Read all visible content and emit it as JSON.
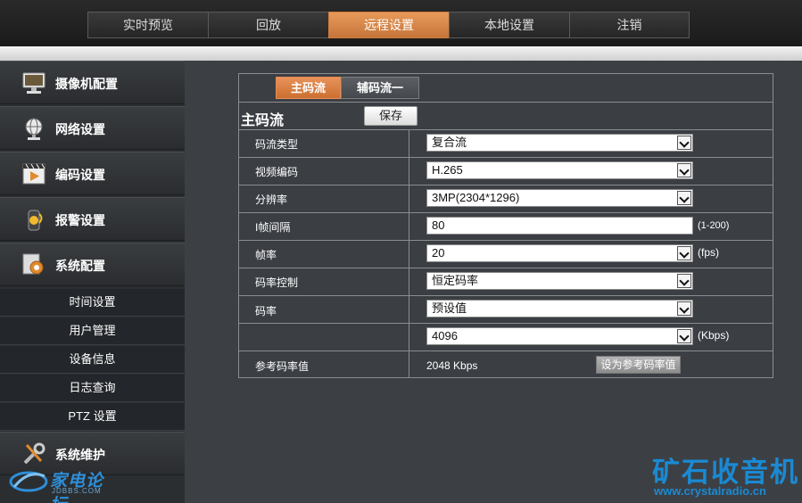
{
  "nav": {
    "tabs": [
      {
        "label": "实时预览",
        "active": false
      },
      {
        "label": "回放",
        "active": false
      },
      {
        "label": "远程设置",
        "active": true
      },
      {
        "label": "本地设置",
        "active": false
      },
      {
        "label": "注销",
        "active": false
      }
    ]
  },
  "sidebar": {
    "items": [
      {
        "label": "摄像机配置",
        "icon": "monitor-icon"
      },
      {
        "label": "网络设置",
        "icon": "globe-icon"
      },
      {
        "label": "编码设置",
        "icon": "film-icon"
      },
      {
        "label": "报警设置",
        "icon": "alarm-icon"
      },
      {
        "label": "系统配置",
        "icon": "system-gear-icon"
      }
    ],
    "sub_items": [
      "时间设置",
      "用户管理",
      "设备信息",
      "日志查询",
      "PTZ 设置"
    ],
    "maintenance": {
      "label": "系统维护",
      "icon": "tools-icon"
    }
  },
  "panel": {
    "tabs": [
      "主码流",
      "辅码流一"
    ],
    "section_title": "主码流",
    "save_label": "保存",
    "rows": {
      "stream_type": {
        "label": "码流类型",
        "value": "复合流"
      },
      "video_codec": {
        "label": "视频编码",
        "value": "H.265"
      },
      "resolution": {
        "label": "分辨率",
        "value": "3MP(2304*1296)"
      },
      "i_frame": {
        "label": "I帧间隔",
        "value": "80",
        "unit": "(1-200)"
      },
      "frame_rate": {
        "label": "帧率",
        "value": "20",
        "unit": "(fps)"
      },
      "rate_control": {
        "label": "码率控制",
        "value": "恒定码率"
      },
      "bitrate": {
        "label": "码率",
        "value": "预设值"
      },
      "bitrate_value": {
        "value": "4096",
        "unit": "(Kbps)"
      },
      "reference": {
        "label": "参考码率值",
        "value": "2048 Kbps",
        "button": "设为参考码率值"
      }
    }
  },
  "watermarks": {
    "left_title": "家电论坛",
    "left_url": "JDBBS.COM",
    "right_title": "矿石收音机",
    "right_url": "www.crystalradio.cn"
  },
  "colors": {
    "accent": "#d07b3c",
    "sidebar_bg": "#2b2e31",
    "panel_bg": "#3b3f44",
    "watermark_blue": "#1a8ad4"
  }
}
